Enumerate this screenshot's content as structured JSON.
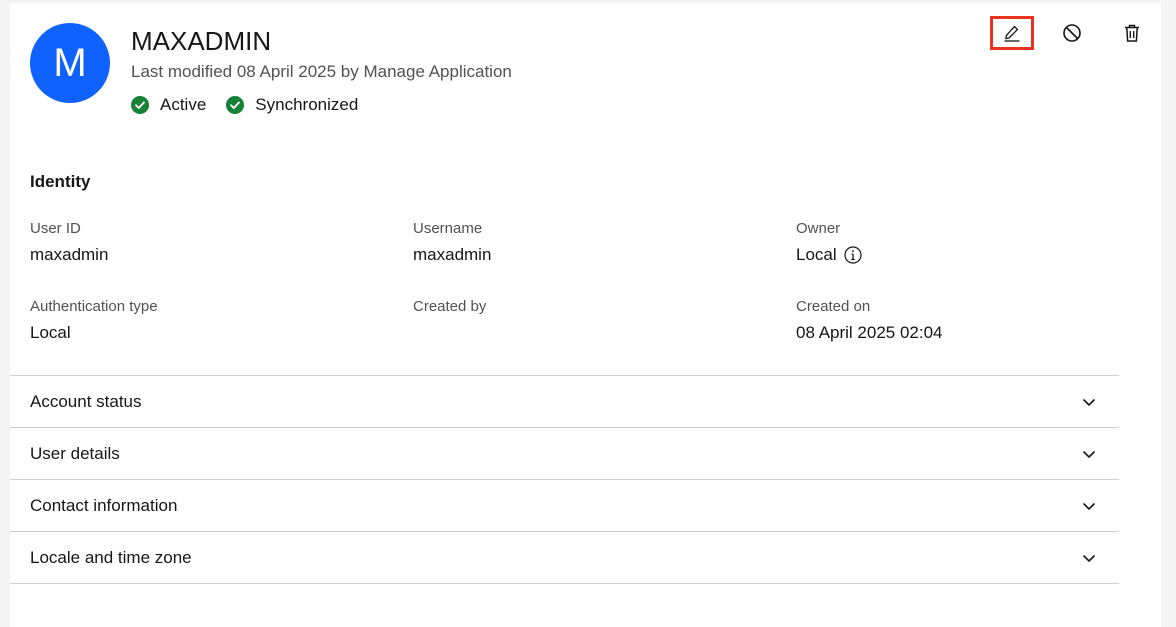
{
  "profile": {
    "avatar_initial": "M",
    "name": "MAXADMIN",
    "last_modified": "Last modified 08 April 2025 by Manage Application",
    "badges": [
      {
        "label": "Active",
        "icon": "check-circle-icon",
        "color": "#198038"
      },
      {
        "label": "Synchronized",
        "icon": "check-circle-icon",
        "color": "#198038"
      }
    ]
  },
  "toolbar": {
    "edit_icon": "edit-icon",
    "disable_icon": "disable-icon",
    "delete_icon": "trash-icon"
  },
  "identity": {
    "title": "Identity",
    "fields": [
      {
        "label": "User ID",
        "value": "maxadmin"
      },
      {
        "label": "Username",
        "value": "maxadmin"
      },
      {
        "label": "Owner",
        "value": "Local"
      },
      {
        "label": "Authentication type",
        "value": "Local"
      },
      {
        "label": "Created by",
        "value": ""
      },
      {
        "label": "Created on",
        "value": "08 April 2025 02:04"
      }
    ]
  },
  "sections": [
    {
      "label": "Account status"
    },
    {
      "label": "User details"
    },
    {
      "label": "Contact information"
    },
    {
      "label": "Locale and time zone"
    }
  ],
  "colors": {
    "accent": "#0f62fe",
    "success": "#198038",
    "highlight": "#e8331f"
  }
}
